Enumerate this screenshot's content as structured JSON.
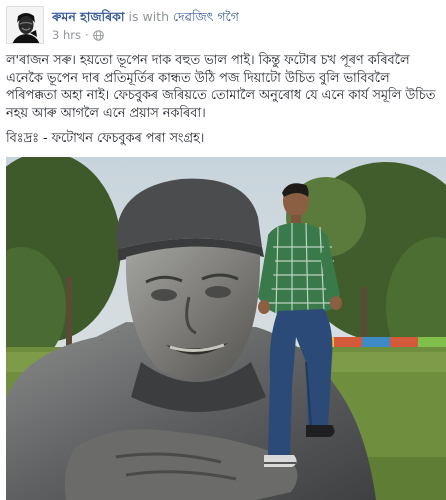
{
  "post": {
    "author_name": "ৰুমন হাজৰিকা",
    "with_text": "is with",
    "tagged_name": "দেৱজিৎ গগৈ",
    "timestamp": "3 hrs",
    "separator": "·",
    "privacy_icon": "globe-icon",
    "avatar_icon": "profile-portrait-icon",
    "paragraph_1": "ল'ৰাজন সৰু। হয়তো ভূপেন দাক বহুত ভাল পাই। কিন্তু ফটোৰ চখ পূৰণ কৰিবলৈ এনেকৈ ভূপেন দাৰ প্ৰতিমূৰ্তিৰ কান্ধত উঠি পজ দিয়াটো উচিত বুলি ভাবিবলৈ পৰিপক্কতা অহা নাই। ফেচবুকৰ জৰিয়তে তোমালৈ অনুৰোধ যে এনে কাৰ্য সমূলি উচিত নহয় আৰু আগলৈ এনে প্ৰয়াস নকৰিবা।",
    "paragraph_2": "বিঃদ্ৰঃ - ফটোখন ফেচবুকৰ পৰা সংগ্ৰহ।",
    "photo_description": "statue-photo"
  },
  "colors": {
    "link": "#365899",
    "muted": "#90949c",
    "text": "#1d2129"
  }
}
